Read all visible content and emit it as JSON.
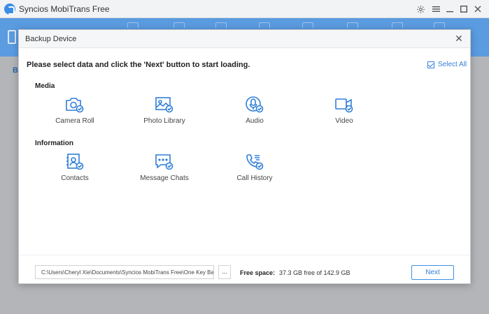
{
  "app": {
    "title": "Syncios MobiTrans Free"
  },
  "background": {
    "partial_label": "B"
  },
  "dialog": {
    "title": "Backup Device",
    "close_symbol": "✕",
    "instruction": "Please select data and click the 'Next' button to start loading.",
    "select_all_label": "Select All",
    "select_all_checked": true,
    "sections": {
      "media": {
        "title": "Media",
        "items": [
          {
            "label": "Camera Roll",
            "icon": "camera-icon",
            "checked": true
          },
          {
            "label": "Photo Library",
            "icon": "photo-icon",
            "checked": true
          },
          {
            "label": "Audio",
            "icon": "microphone-icon",
            "checked": true
          },
          {
            "label": "Video",
            "icon": "video-camera-icon",
            "checked": true
          }
        ]
      },
      "information": {
        "title": "Information",
        "items": [
          {
            "label": "Contacts",
            "icon": "contacts-icon",
            "checked": true
          },
          {
            "label": "Message Chats",
            "icon": "chat-icon",
            "checked": true
          },
          {
            "label": "Call History",
            "icon": "phone-icon",
            "checked": true
          }
        ]
      }
    },
    "footer": {
      "path_value": "C:\\Users\\Cheryl Xie\\Documents\\Syncios MobiTrans Free\\One Key Backi",
      "browse_label": "...",
      "free_space_label": "Free space:",
      "free_space_value": "37.3 GB free of 142.9 GB",
      "next_label": "Next"
    }
  },
  "colors": {
    "accent": "#2f7fd8",
    "toolbar": "#5b9be0",
    "check_badge": "#2f7fd8"
  }
}
